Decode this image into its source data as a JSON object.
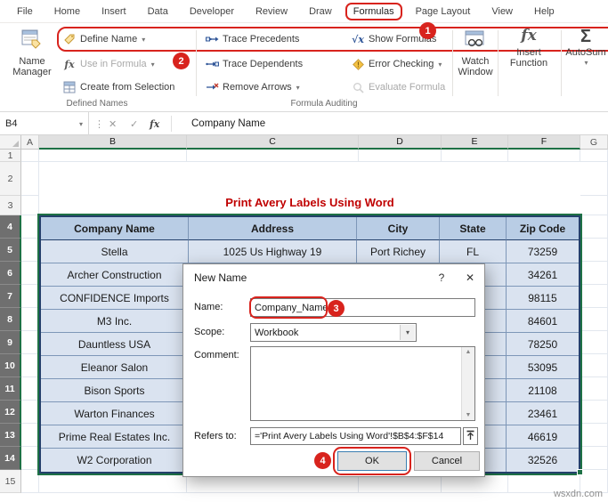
{
  "ribbon": {
    "tabs": [
      {
        "label": "File"
      },
      {
        "label": "Home"
      },
      {
        "label": "Insert"
      },
      {
        "label": "Data"
      },
      {
        "label": "Developer"
      },
      {
        "label": "Review"
      },
      {
        "label": "Draw"
      },
      {
        "label": "Formulas"
      },
      {
        "label": "Page Layout"
      },
      {
        "label": "View"
      },
      {
        "label": "Help"
      }
    ],
    "active_tab": "Formulas",
    "defined_names": {
      "label": "Defined Names",
      "name_manager": "Name Manager",
      "define_name": "Define Name",
      "use_in_formula": "Use in Formula",
      "create_from_selection": "Create from Selection"
    },
    "formula_auditing": {
      "label": "Formula Auditing",
      "trace_precedents": "Trace Precedents",
      "trace_dependents": "Trace Dependents",
      "remove_arrows": "Remove Arrows",
      "show_formulas": "Show Formulas",
      "error_checking": "Error Checking",
      "evaluate_formula": "Evaluate Formula"
    },
    "watch_window": "Watch Window",
    "insert_function": "Insert Function",
    "autosum": "AutoSum"
  },
  "icons": {
    "dropdown": "▾",
    "dots": "⋮",
    "cancel": "✕",
    "enter": "✓",
    "fx": "fx",
    "scroll_up": "▲",
    "scroll_down": "▼",
    "sigma": "Σ",
    "help": "?",
    "close": "✕"
  },
  "annotations": {
    "step1": "1",
    "step2": "2",
    "step3": "3",
    "step4": "4"
  },
  "formula_bar": {
    "name_box": "B4",
    "value": "Company Name"
  },
  "sheet": {
    "column_headers": [
      "A",
      "B",
      "C",
      "D",
      "E",
      "F",
      "G"
    ],
    "row_headers": [
      "1",
      "2",
      "3",
      "4",
      "5",
      "6",
      "7",
      "8",
      "9",
      "10",
      "11",
      "12",
      "13",
      "14",
      "15"
    ],
    "selection": {
      "cols": "B:F",
      "rows": "4:14"
    },
    "title": "Print Avery Labels Using Word",
    "table": {
      "headers": [
        "Company Name",
        "Address",
        "City",
        "State",
        "Zip Code"
      ],
      "rows": [
        [
          "Stella",
          "1025 Us Highway 19",
          "Port Richey",
          "FL",
          "73259"
        ],
        [
          "Archer Construction",
          "",
          "",
          "",
          "34261"
        ],
        [
          "CONFIDENCE Imports",
          "",
          "",
          "",
          "98115"
        ],
        [
          "M3 Inc.",
          "",
          "",
          "",
          "84601"
        ],
        [
          "Dauntless USA",
          "",
          "",
          "",
          "78250"
        ],
        [
          "Eleanor Salon",
          "",
          "",
          "",
          "53095"
        ],
        [
          "Bison Sports",
          "",
          "",
          "",
          "21108"
        ],
        [
          "Warton Finances",
          "",
          "",
          "",
          "23461"
        ],
        [
          "Prime Real Estates Inc.",
          "",
          "",
          "",
          "46619"
        ],
        [
          "W2 Corporation",
          "",
          "",
          "",
          "32526"
        ]
      ]
    }
  },
  "dialog": {
    "title": "New Name",
    "name_label": "Name:",
    "name_value": "Company_Name",
    "scope_label": "Scope:",
    "scope_value": "Workbook",
    "comment_label": "Comment:",
    "refers_label": "Refers to:",
    "refers_value": "='Print Avery Labels Using Word'!$B$4:$F$14",
    "ok_label": "OK",
    "cancel_label": "Cancel"
  },
  "watermark": "wsxdn.com",
  "colors": {
    "annotation_red": "#D8231D",
    "selection_green": "#1E7145",
    "title_red": "#C00000",
    "table_header_fill": "#B9CDE5",
    "table_row_fill": "#DAE3F0",
    "table_border": "#24406B"
  }
}
